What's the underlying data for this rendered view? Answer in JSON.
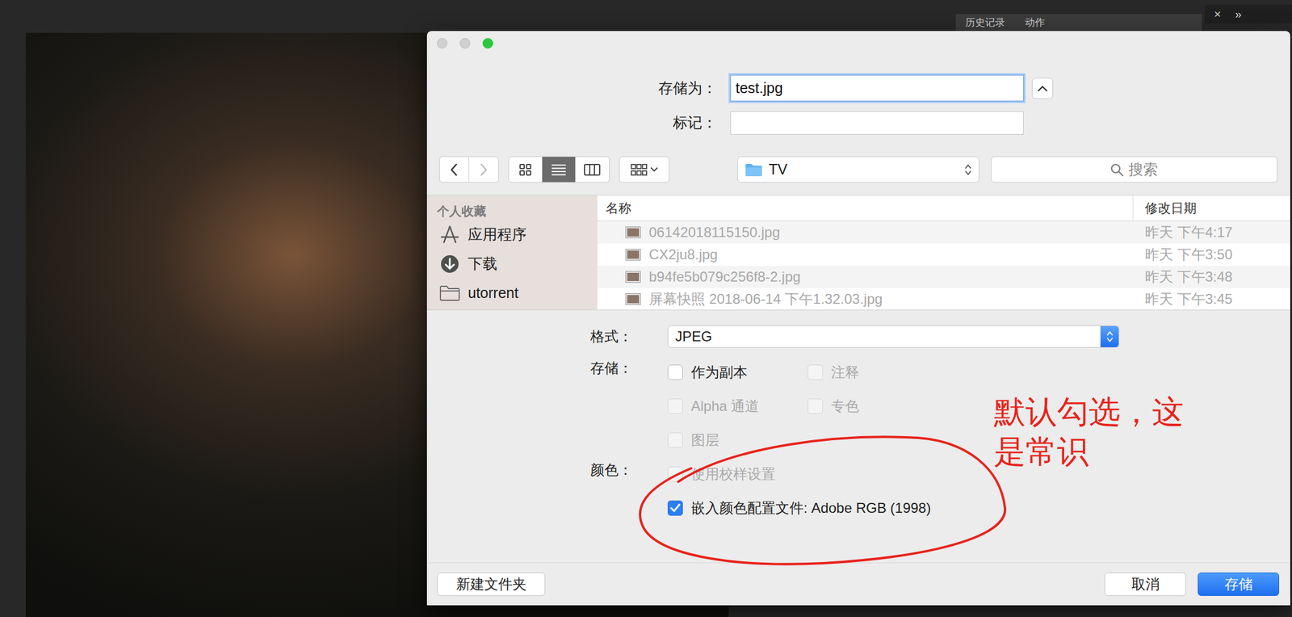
{
  "workspace": {
    "panel_tabs": [
      "历史记录",
      "动作"
    ],
    "panel_controls": [
      "×",
      "»"
    ]
  },
  "dialog": {
    "window_controls": [
      {
        "kind": "close",
        "disabled": true
      },
      {
        "kind": "minimize",
        "disabled": true
      },
      {
        "kind": "zoom",
        "disabled": false
      }
    ],
    "save_as": {
      "label": "存储为：",
      "value": "test.jpg"
    },
    "tags": {
      "label": "标记："
    },
    "toolbar": {
      "nav": [
        {
          "kind": "back",
          "disabled": false
        },
        {
          "kind": "forward",
          "disabled": true
        }
      ],
      "views": [
        {
          "kind": "icons",
          "selected": false
        },
        {
          "kind": "list",
          "selected": true
        },
        {
          "kind": "columns",
          "selected": false
        }
      ],
      "location": "TV",
      "search_placeholder": "搜索"
    },
    "sidebar": {
      "header": "个人收藏",
      "items": [
        {
          "label": "应用程序",
          "kind": "apps"
        },
        {
          "label": "下载",
          "kind": "downloads"
        },
        {
          "label": "utorrent",
          "kind": "folder"
        }
      ]
    },
    "files": {
      "columns": [
        "名称",
        "修改日期"
      ],
      "rows": [
        {
          "name": "06142018115150.jpg",
          "date": "昨天 下午4:17",
          "disabled": true
        },
        {
          "name": "CX2ju8.jpg",
          "date": "昨天 下午3:50",
          "disabled": true
        },
        {
          "name": "b94fe5b079c256f8-2.jpg",
          "date": "昨天 下午3:48",
          "disabled": true
        },
        {
          "name": "屏幕快照 2018-06-14 下午1.32.03.jpg",
          "date": "昨天 下午3:45",
          "disabled": true
        }
      ]
    },
    "format": {
      "label": "格式：",
      "value": "JPEG"
    },
    "save_options": {
      "label": "存储：",
      "items": [
        {
          "label": "作为副本",
          "checked": false,
          "disabled": false
        },
        {
          "label": "注释",
          "checked": false,
          "disabled": true
        },
        {
          "label": "Alpha 通道",
          "checked": false,
          "disabled": true
        },
        {
          "label": "专色",
          "checked": false,
          "disabled": true
        },
        {
          "label": "图层",
          "checked": false,
          "disabled": true
        }
      ]
    },
    "color_options": {
      "label": "颜色：",
      "items": [
        {
          "label": "使用校样设置",
          "checked": false,
          "disabled": true
        },
        {
          "label": "嵌入颜色配置文件: Adobe RGB (1998)",
          "checked": true,
          "disabled": false
        }
      ]
    },
    "buttons": [
      {
        "label": "新建文件夹",
        "default": false
      },
      {
        "label": "取消",
        "default": false
      },
      {
        "label": "存储",
        "default": true
      }
    ]
  },
  "annotation": {
    "text": "默认勾选，这是常识"
  }
}
